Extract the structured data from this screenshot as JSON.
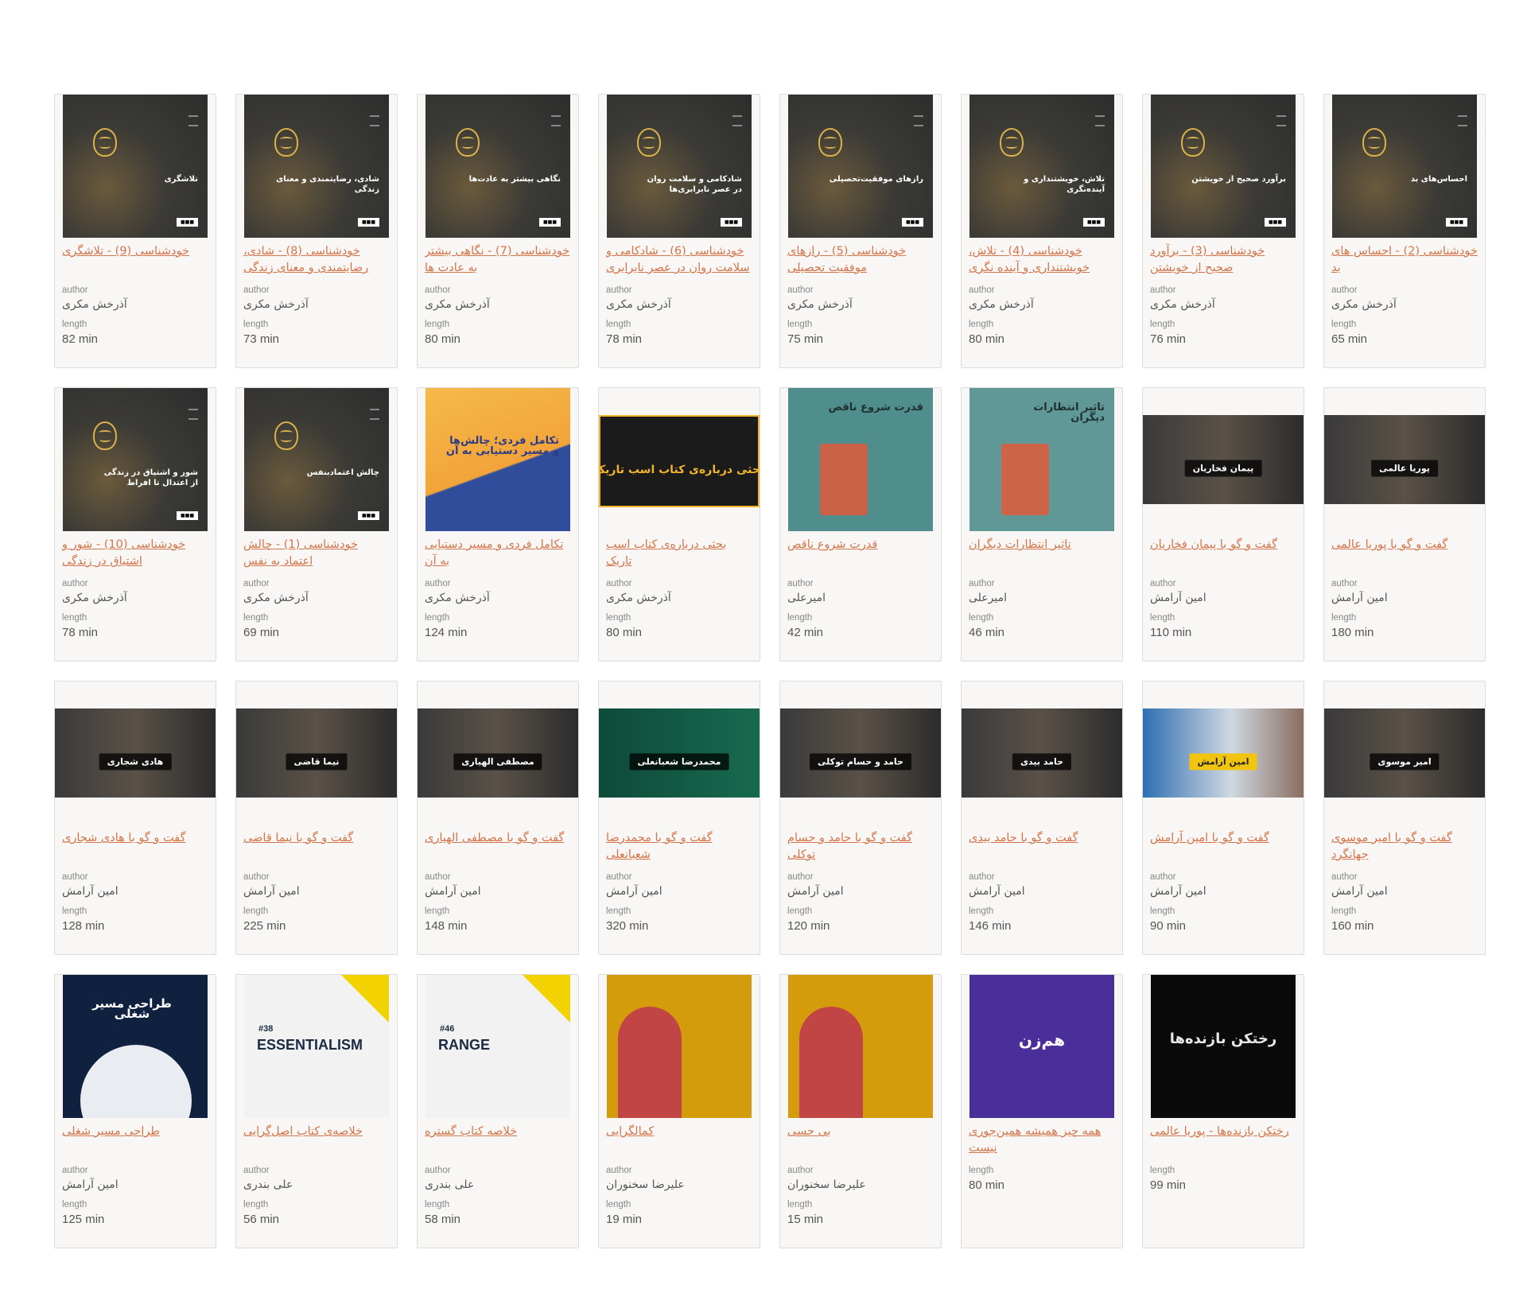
{
  "labels": {
    "author": "author",
    "length": "length"
  },
  "cards": [
    {
      "title": "خودشناسی (9) - تلاشگری",
      "author": "آذرخش مکری",
      "length": "82 min",
      "cover": "dark",
      "cover_text": "تلاشگری"
    },
    {
      "title": "خودشناسی (8) - شادی، رضایتمندی و معنای زندگی",
      "author": "آذرخش مکری",
      "length": "73 min",
      "cover": "dark",
      "cover_text": "شادی، رضایتمندی و معنای زندگی"
    },
    {
      "title": "خودشناسی (7) - نگاهی بیشتر به عادت ها",
      "author": "آذرخش مکری",
      "length": "80 min",
      "cover": "dark",
      "cover_text": "نگاهی بیشتر به عادت‌ها"
    },
    {
      "title": "خودشناسی (6) - شادکامی و سلامت روان در عصر نابرابری",
      "author": "آذرخش مکری",
      "length": "78 min",
      "cover": "dark",
      "cover_text": "شادکامی و سلامت روان در عصر نابرابری‌ها"
    },
    {
      "title": "خودشناسی (5) - رازهای موفقیت تحصیلی",
      "author": "آذرخش مکری",
      "length": "75 min",
      "cover": "dark",
      "cover_text": "رازهای موفقیت‌تحصیلی"
    },
    {
      "title": "خودشناسی (4) - تلاش، خویشتنداری و آینده نگری",
      "author": "آذرخش مکری",
      "length": "80 min",
      "cover": "dark",
      "cover_text": "تلاش، خویشتنداری و آینده‌نگری"
    },
    {
      "title": "خودشناسی (3) - برآورد صحیح از خویشتن",
      "author": "آذرخش مکری",
      "length": "76 min",
      "cover": "dark",
      "cover_text": "برآورد صحیح از خویشتن"
    },
    {
      "title": "خودشناسی (2) - احساس های بد",
      "author": "آذرخش مکری",
      "length": "65 min",
      "cover": "dark",
      "cover_text": "احساس‌های بد"
    },
    {
      "title": "خودشناسی (10) - شور و اشتیاق در زندگی",
      "author": "آذرخش مکری",
      "length": "78 min",
      "cover": "dark",
      "cover_text": "شور و اشتیاق در زندگی از اعتدال تا افراط"
    },
    {
      "title": "خودشناسی (1) - چالش اعتماد به نفس",
      "author": "آذرخش مکری",
      "length": "69 min",
      "cover": "dark",
      "cover_text": "چالش اعتمادبنفس"
    },
    {
      "title": "تکامل فردی و مسیر دستیابی به آن",
      "author": "آذرخش مکری",
      "length": "124 min",
      "cover": "orange",
      "cover_text": "تکامل فردی؛ چالش‌ها و مسیر دستیابی به آن"
    },
    {
      "title": "بحثی درباره‌ی کتاب اسب تاریک",
      "author": "آذرخش مکری",
      "length": "80 min",
      "cover": "darkhorse",
      "cover_text": "بحثی درباره‌ی کتاب اسب تاریک"
    },
    {
      "title": "قدرت شروع ناقص",
      "author": "امیرعلی",
      "length": "42 min",
      "cover": "teal",
      "cover_text": "قدرت شروع ناقص"
    },
    {
      "title": "تاثیر انتظارات دیگران",
      "author": "امیرعلی",
      "length": "46 min",
      "cover": "teal2",
      "cover_text": "تاثیر انتظارات دیگران"
    },
    {
      "title": "گفت و گو با پیمان فخاریان",
      "author": "امین آرامش",
      "length": "110 min",
      "cover": "video",
      "cover_text": "پیمان فخاریان"
    },
    {
      "title": "گفت و گو با پوریا عالمی",
      "author": "امین آرامش",
      "length": "180 min",
      "cover": "video",
      "cover_text": "پوریا عالمی"
    },
    {
      "title": "گفت و گو با هادی شجاری",
      "author": "امین آرامش",
      "length": "128 min",
      "cover": "video",
      "cover_text": "هادی شجاری"
    },
    {
      "title": "گفت و گو با نیما قاضی",
      "author": "امین آرامش",
      "length": "225 min",
      "cover": "video",
      "cover_text": "نیما قاضی"
    },
    {
      "title": "گفت و گو با مصطفی الهیاری",
      "author": "امین آرامش",
      "length": "148 min",
      "cover": "video",
      "cover_text": "مصطفی الهیاری"
    },
    {
      "title": "گفت و گو با محمدرضا شعبانعلی",
      "author": "امین آرامش",
      "length": "320 min",
      "cover": "green",
      "cover_text": "محمدرضا شعبانعلی"
    },
    {
      "title": "گفت و گو با حامد و حسام توکلی",
      "author": "امین آرامش",
      "length": "120 min",
      "cover": "video",
      "cover_text": "حامد و حسام توکلی"
    },
    {
      "title": "گفت و گو با حامد بیدی",
      "author": "امین آرامش",
      "length": "146 min",
      "cover": "video",
      "cover_text": "حامد بیدی"
    },
    {
      "title": "گفت و گو با امین آرامش",
      "author": "امین آرامش",
      "length": "90 min",
      "cover": "videoblue",
      "cover_text": "امین آرامش"
    },
    {
      "title": "گفت و گو با امیر موسوی جهانگرد",
      "author": "امین آرامش",
      "length": "160 min",
      "cover": "video",
      "cover_text": "امیر موسوی"
    },
    {
      "title": "طراحی مسیر شغلی",
      "author": "امین آرامش",
      "length": "125 min",
      "cover": "navy",
      "cover_text": "طراحی مسیر شغلی"
    },
    {
      "title": "خلاصه‌ی کتاب اصل‌گرایی",
      "author": "علی بندری",
      "length": "56 min",
      "cover": "white",
      "cover_text": "ESSENTIALISM",
      "cover_num": "#38"
    },
    {
      "title": "خلاصه کتاب گستره",
      "author": "علی بندری",
      "length": "58 min",
      "cover": "white",
      "cover_text": "RANGE",
      "cover_num": "#46"
    },
    {
      "title": "کمالگرایی",
      "author": "علیرضا سخنوران",
      "length": "19 min",
      "cover": "mustard",
      "cover_text": ""
    },
    {
      "title": "بی حسی",
      "author": "علیرضا سخنوران",
      "length": "15 min",
      "cover": "mustard",
      "cover_text": ""
    },
    {
      "title": "همه چیز همیشه همین‌جوری نیست",
      "author": "",
      "length": "80 min",
      "cover": "purple",
      "cover_text": "هم‌زن"
    },
    {
      "title": "رختکن بازنده‌ها - پوریا عالمی",
      "author": "",
      "length": "99 min",
      "cover": "black",
      "cover_text": "رختکن بازنده‌ها"
    }
  ]
}
